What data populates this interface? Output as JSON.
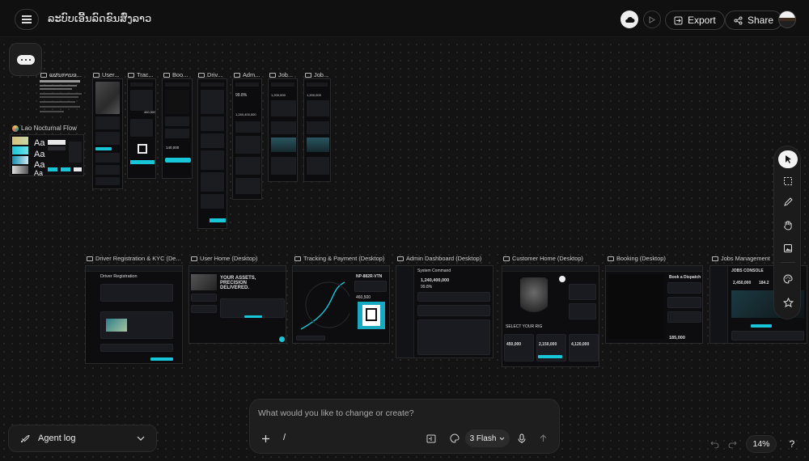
{
  "header": {
    "title": "ລະບົບເອີ້ນລົດຂົນສົ່ງລາວ",
    "export_label": "Export",
    "share_label": "Share"
  },
  "design_system": {
    "label": "Lao Nocturnal Flow",
    "type_sample": "Aa"
  },
  "mobile_frames": [
    {
      "label": "ແຜນການອ..."
    },
    {
      "label": "User..."
    },
    {
      "label": "Trac..."
    },
    {
      "label": "Boo..."
    },
    {
      "label": "Driv..."
    },
    {
      "label": "Adm..."
    },
    {
      "label": "Job..."
    },
    {
      "label": "Job..."
    }
  ],
  "desktop_frames": [
    {
      "label": "Driver Registration & KYC (De..."
    },
    {
      "label": "User Home (Desktop)"
    },
    {
      "label": "Tracking & Payment (Desktop)"
    },
    {
      "label": "Admin Dashboard (Desktop)"
    },
    {
      "label": "Customer Home (Desktop)"
    },
    {
      "label": "Booking (Desktop)"
    },
    {
      "label": "Jobs Management (..."
    }
  ],
  "previews": {
    "driver_reg_title": "Driver Registration",
    "user_home_headline": "YOUR ASSETS, PRECISION DELIVERED.",
    "tracking_code": "NP-882R-VTN",
    "tracking_amount": "460,500",
    "admin_title": "System Command",
    "admin_value": "1,240,400,000",
    "admin_percent": "99.8%",
    "customer_label": "SELECT YOUR RIG",
    "customer_value_1": "450,000",
    "customer_value_2": "2,150,000",
    "customer_value_3": "4,120,000",
    "booking_title": "Book a Dispatch",
    "booking_amount": "185,000",
    "jobs_title": "JOBS CONSOLE",
    "jobs_value_1": "2,450,000",
    "jobs_value_2": "184.2",
    "mobile_admin_percent": "99.8%",
    "mobile_admin_value": "1,240,400,000",
    "mobile_jobs_value": "1,200,000",
    "mobile_track_value": "460,500",
    "mobile_book_value": "140,000"
  },
  "right_toolbar": {
    "tools": [
      "cursor-icon",
      "select-area-icon",
      "pen-icon",
      "hand-icon",
      "image-icon",
      "palette-icon",
      "star-icon"
    ]
  },
  "agent_log": {
    "label": "Agent log"
  },
  "prompt": {
    "placeholder": "What would you like to change or create?",
    "slash": "/",
    "model_label": "3 Flash"
  },
  "zoom": {
    "level": "14%",
    "help": "?"
  },
  "colors": {
    "accent": "#17c6d8",
    "canvas": "#131313",
    "panel": "#1e1e1e"
  }
}
